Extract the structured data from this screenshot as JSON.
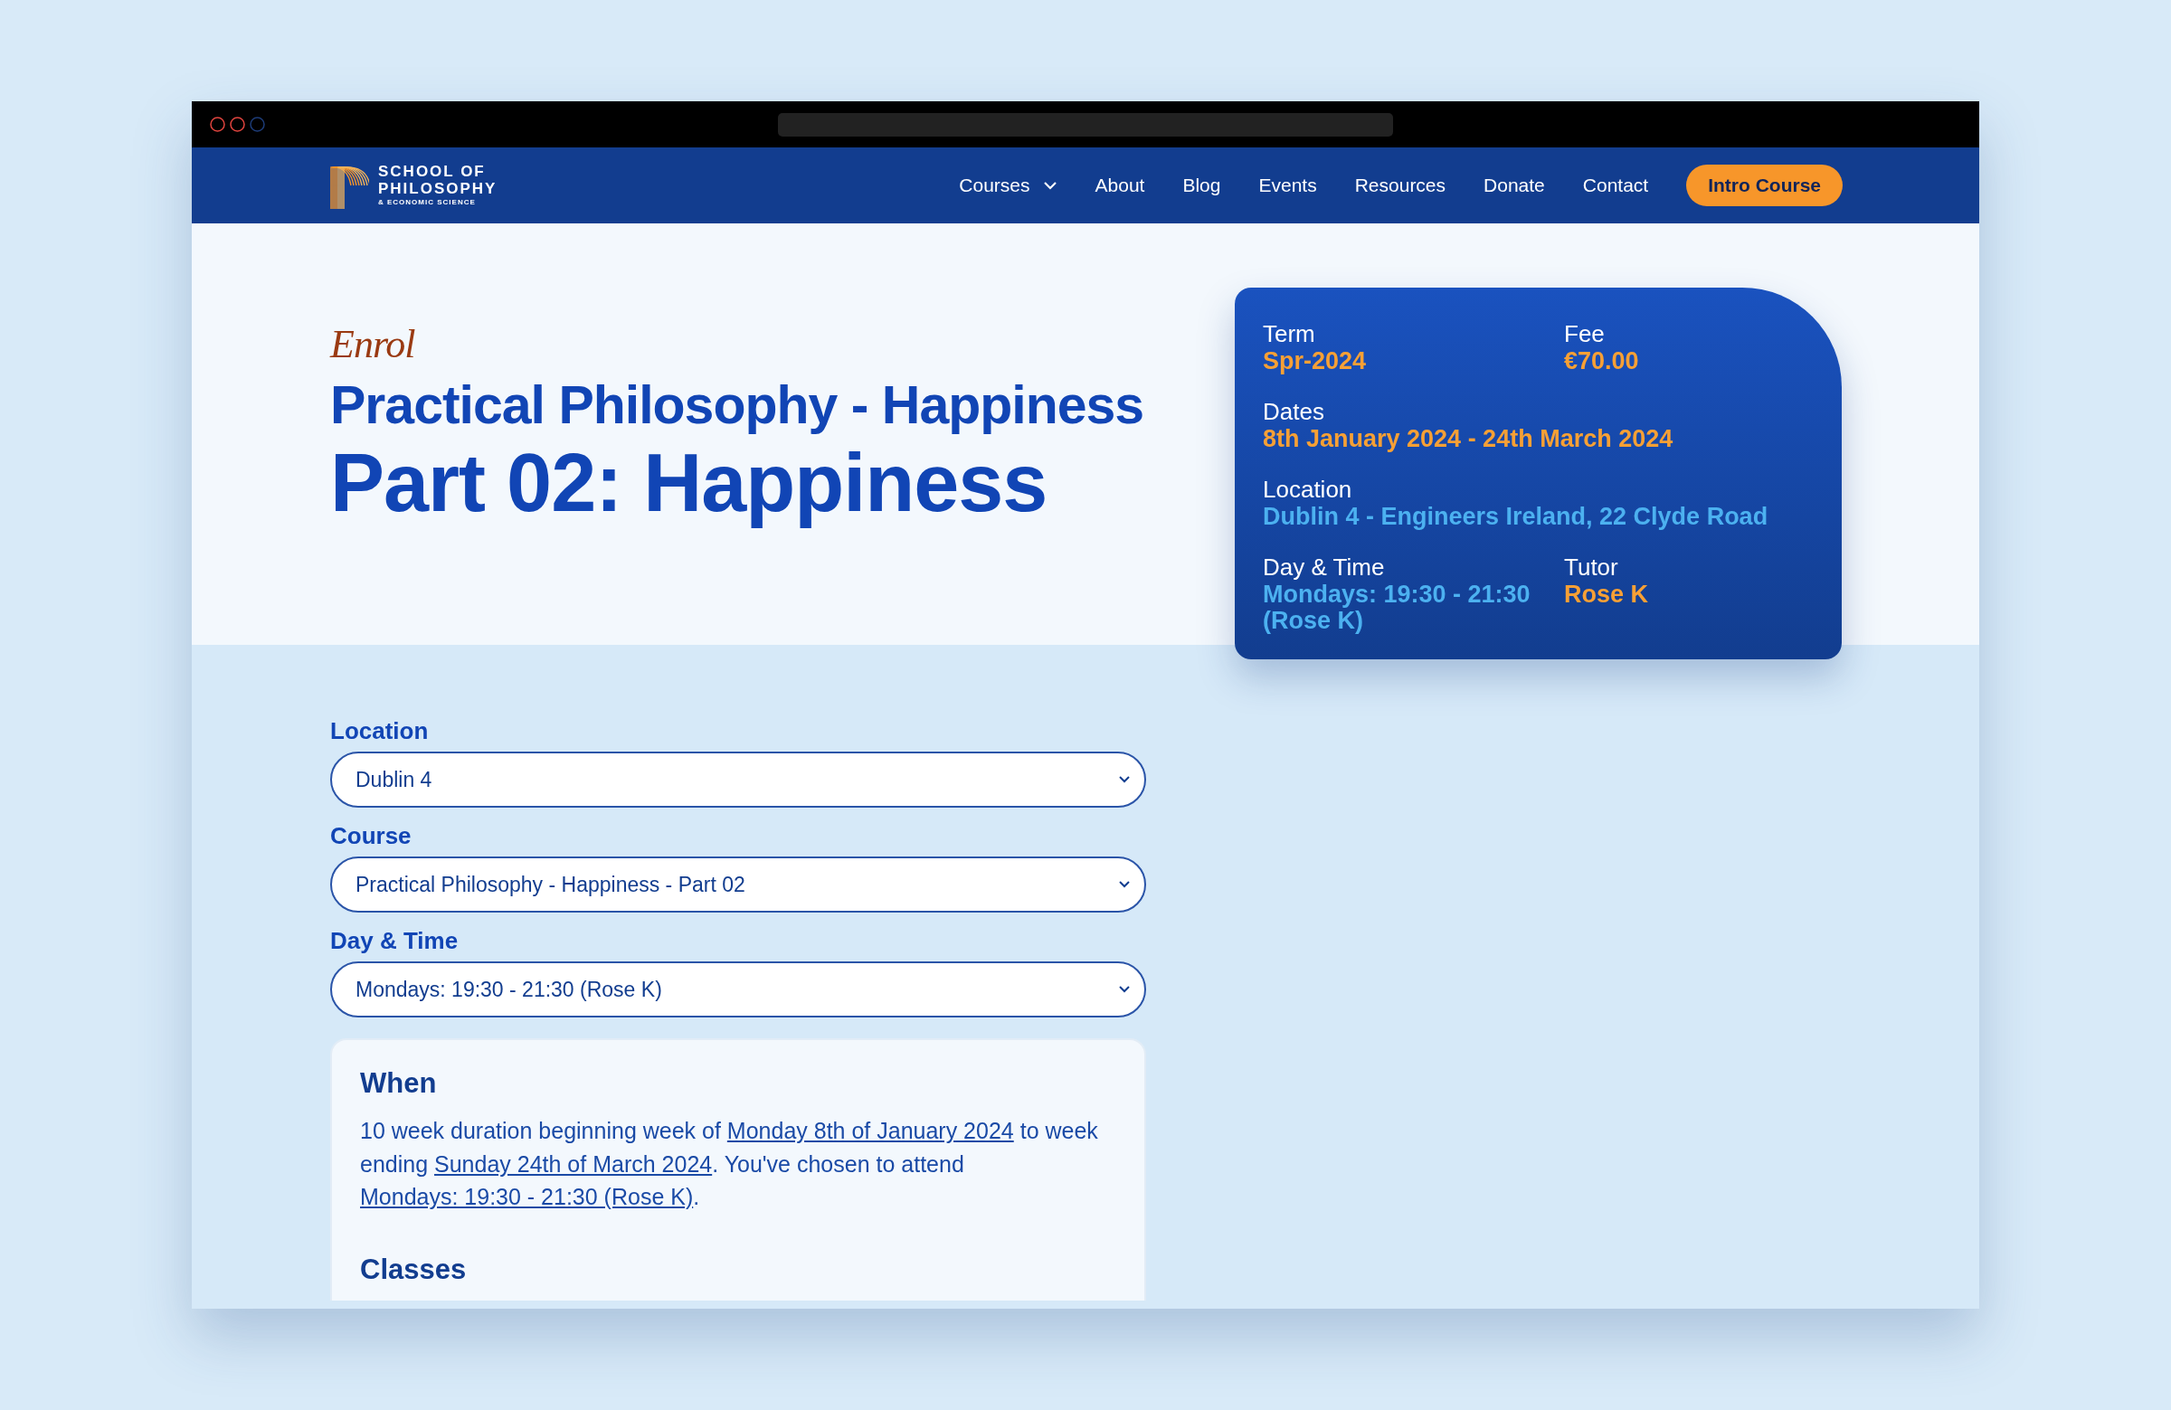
{
  "nav": {
    "logo_lines": [
      "SCHOOL OF",
      "PHILOSOPHY",
      "& ECONOMIC SCIENCE"
    ],
    "links": [
      {
        "label": "Courses",
        "has_dropdown": true
      },
      {
        "label": "About",
        "has_dropdown": false
      },
      {
        "label": "Blog",
        "has_dropdown": false
      },
      {
        "label": "Events",
        "has_dropdown": false
      },
      {
        "label": "Resources",
        "has_dropdown": false
      },
      {
        "label": "Donate",
        "has_dropdown": false
      },
      {
        "label": "Contact",
        "has_dropdown": false
      }
    ],
    "cta": "Intro Course"
  },
  "hero": {
    "eyebrow": "Enrol",
    "title": "Practical Philosophy - Happiness",
    "subtitle": "Part 02: Happiness"
  },
  "info_card": {
    "fields": [
      {
        "label": "Term",
        "value": "Spr-2024",
        "color": "#f7a035",
        "kind": "narrow"
      },
      {
        "label": "Fee",
        "value": "€70.00",
        "color": "#f7a035",
        "kind": "narrow"
      },
      {
        "label": "Dates",
        "value": "8th January 2024 - 24th March 2024",
        "color": "#f7a035",
        "kind": "wide"
      },
      {
        "label": "Location",
        "value": "Dublin 4 - Engineers Ireland, 22 Clyde Road",
        "color": "#4cb1f0",
        "kind": "wide"
      },
      {
        "label": "Day & Time",
        "value": "Mondays: 19:30 - 21:30 (Rose K)",
        "color": "#4cb1f0",
        "kind": "narrow"
      },
      {
        "label": "Tutor",
        "value": "Rose K",
        "color": "#f7a035",
        "kind": "narrow"
      }
    ]
  },
  "form": {
    "fields": [
      {
        "label": "Location",
        "value": "Dublin 4"
      },
      {
        "label": "Course",
        "value": "Practical Philosophy - Happiness - Part 02"
      },
      {
        "label": "Day & Time",
        "value": "Mondays: 19:30 - 21:30 (Rose K)"
      }
    ]
  },
  "when": {
    "heading": "When",
    "paragraph": [
      {
        "kind": "text",
        "text": "10 week duration beginning week of "
      },
      {
        "kind": "link",
        "text": "Monday 8th of January 2024"
      },
      {
        "kind": "text",
        "text": " to week ending "
      },
      {
        "kind": "link",
        "text": "Sunday 24th of March 2024"
      },
      {
        "kind": "text",
        "text": ". You've chosen to attend "
      },
      {
        "kind": "link",
        "text": "Mondays: 19:30 - 21:30 (Rose K)"
      },
      {
        "kind": "text",
        "text": "."
      }
    ],
    "next_heading": "Classes"
  }
}
